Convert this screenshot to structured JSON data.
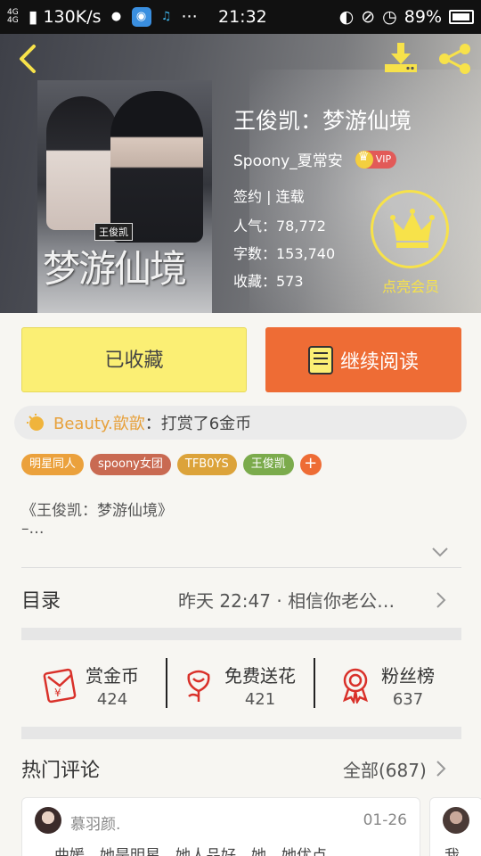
{
  "status_bar": {
    "network": "4G 4G",
    "speed": "130K/s",
    "time": "21:32",
    "battery": "89%",
    "icons": [
      "chat-icon",
      "app-icon",
      "notify-icon",
      "more-dots-icon",
      "headset-icon",
      "mute-icon",
      "alarm-icon",
      "battery-icon"
    ]
  },
  "header": {
    "cover_tag": "王俊凯",
    "cover_title": "梦游仙境",
    "book_title": "王俊凯：梦游仙境",
    "author": "Spoony_夏常安",
    "vip_label": "VIP",
    "status": "签约 | 连载",
    "popularity": "人气：78,772",
    "word_count": "字数：153,740",
    "favorites": "收藏：573",
    "member_label": "点亮会员",
    "colors": {
      "member_gold": "#f7e24a"
    }
  },
  "actions": {
    "favorited_label": "已收藏",
    "continue_label": "继续阅读",
    "colors": {
      "favorited_bg": "#fbef74",
      "continue_bg": "#ee6c35"
    }
  },
  "ticker": {
    "user": "Beauty.歆歆",
    "text": "：打赏了6金币"
  },
  "tags": [
    {
      "label": "明星同人",
      "color": "#eba13c"
    },
    {
      "label": "spoony女团",
      "color": "#c96a52"
    },
    {
      "label": "TFB0YS",
      "color": "#dca33a"
    },
    {
      "label": "王俊凯",
      "color": "#7bab4c"
    }
  ],
  "intro": {
    "line1": "《王俊凯：梦游仙境》",
    "line2": "–…"
  },
  "toc": {
    "label": "目录",
    "latest": "昨天 22:47 · 相信你老公…"
  },
  "stats": [
    {
      "icon": "red-envelope-icon",
      "label": "赏金币",
      "count": "424"
    },
    {
      "icon": "flower-icon",
      "label": "免费送花",
      "count": "421"
    },
    {
      "icon": "award-ribbon-icon",
      "label": "粉丝榜",
      "count": "637"
    }
  ],
  "comments": {
    "title": "热门评论",
    "all_label": "全部(687)",
    "items": [
      {
        "user": "慕羽颜.",
        "date": "01-26",
        "text": "曲媛，她是明星，她人品好，她…她优点"
      },
      {
        "text": "我"
      }
    ]
  }
}
